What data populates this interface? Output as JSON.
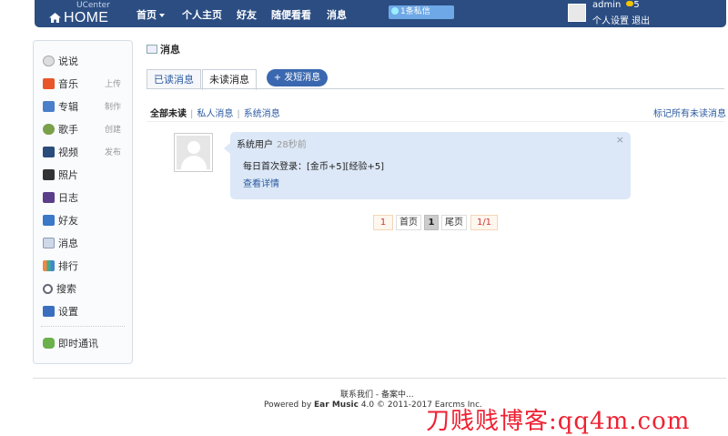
{
  "topbar": {
    "logo_small": "UCenter",
    "logo_big": "HOME",
    "nav": [
      "首页",
      "个人主页",
      "好友",
      "随便看看",
      "消息"
    ],
    "pm_badge": "1条私信",
    "username": "admin",
    "coins": "5",
    "settings": "个人设置",
    "logout": "退出"
  },
  "sidebar": {
    "items": [
      {
        "label": "说说",
        "icon": "chat-icon",
        "extra": ""
      },
      {
        "label": "音乐",
        "icon": "music-icon",
        "extra": "上传"
      },
      {
        "label": "专辑",
        "icon": "album-icon",
        "extra": "制作"
      },
      {
        "label": "歌手",
        "icon": "singer-icon",
        "extra": "创建"
      },
      {
        "label": "视频",
        "icon": "video-icon",
        "extra": "发布"
      },
      {
        "label": "照片",
        "icon": "camera-icon",
        "extra": ""
      },
      {
        "label": "日志",
        "icon": "blog-icon",
        "extra": ""
      },
      {
        "label": "好友",
        "icon": "friends-icon",
        "extra": ""
      },
      {
        "label": "消息",
        "icon": "message-icon",
        "extra": ""
      },
      {
        "label": "排行",
        "icon": "chart-icon",
        "extra": ""
      },
      {
        "label": "搜索",
        "icon": "search-icon",
        "extra": ""
      },
      {
        "label": "设置",
        "icon": "settings-icon",
        "extra": ""
      }
    ],
    "im": "即时通讯"
  },
  "main": {
    "title": "消息",
    "tabs": [
      "已读消息",
      "未读消息"
    ],
    "send_button": "发短消息",
    "filters": [
      "全部未读",
      "私人消息",
      "系统消息"
    ],
    "mark_all": "标记所有未读消息"
  },
  "message": {
    "sender": "系统用户",
    "time": "28秒前",
    "text": "每日首次登录：[金币+5][经验+5]",
    "link": "查看详情",
    "close": "×"
  },
  "pagination": {
    "total": "1",
    "first": "首页",
    "current": "1",
    "last": "尾页",
    "pages": "1/1"
  },
  "footer": {
    "line1": "联系我们 - 备案中...",
    "powered_prefix": "Powered by ",
    "product": "Ear Music",
    "powered_suffix": " 4.0 © 2011-2017 Earcms Inc."
  },
  "watermark": "刀贱贱博客:qq4m.com",
  "colors": {
    "topbar": "#2b4d82",
    "accent": "#3a68b0",
    "bubble": "#dce8f7"
  }
}
